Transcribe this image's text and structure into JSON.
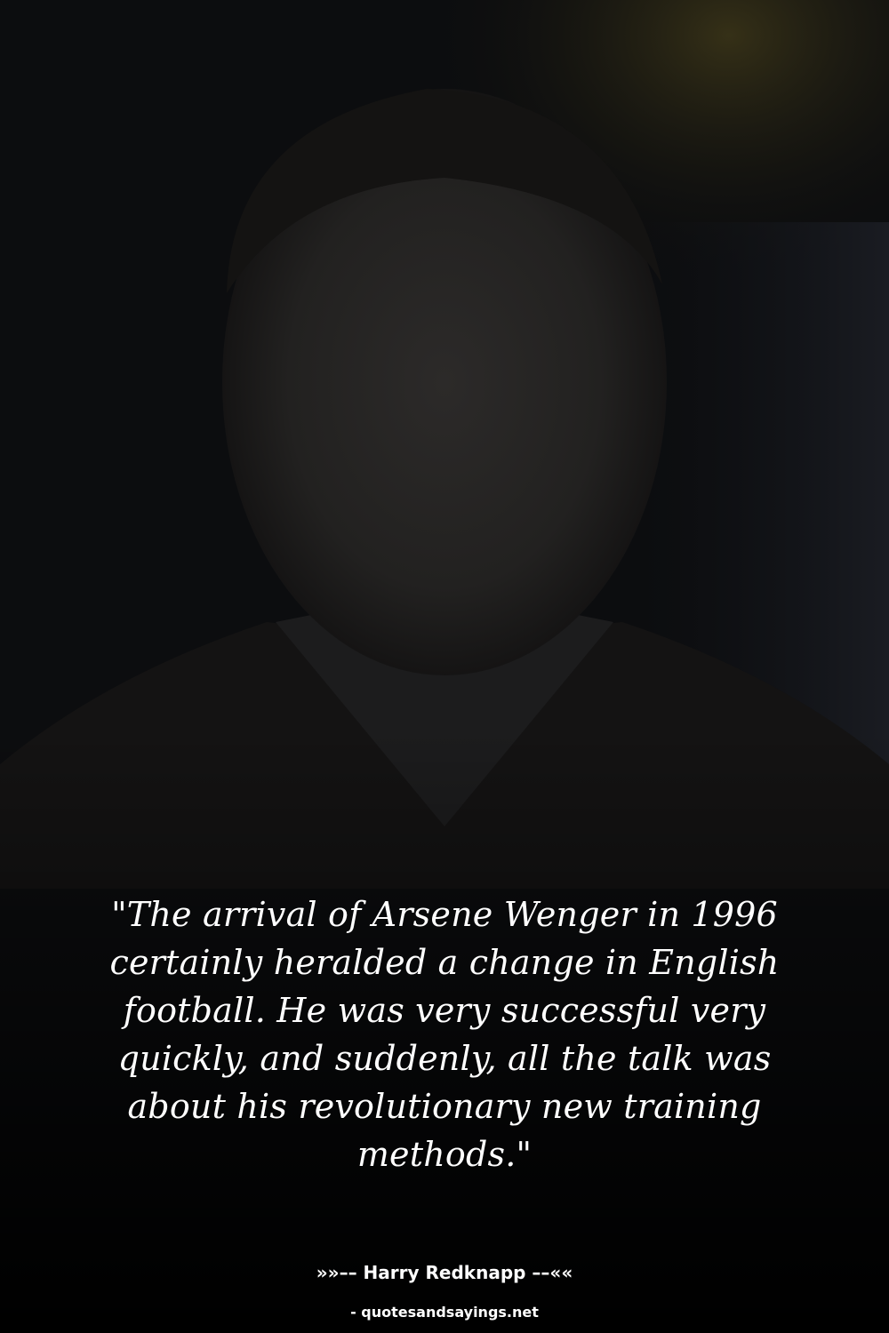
{
  "quote": {
    "text": "\"The arrival of Arsene Wenger in 1996 certainly heralded a change in English football. He was very successful very quickly, and suddenly, all the talk was about his revolutionary new training methods.\""
  },
  "author": {
    "line": "»»–– Harry Redknapp ––««"
  },
  "source": {
    "line": "- quotesandsayings.net"
  },
  "colors": {
    "background": "#0a0a0a",
    "text": "#ffffff",
    "accent_glow": "#3a3418"
  }
}
